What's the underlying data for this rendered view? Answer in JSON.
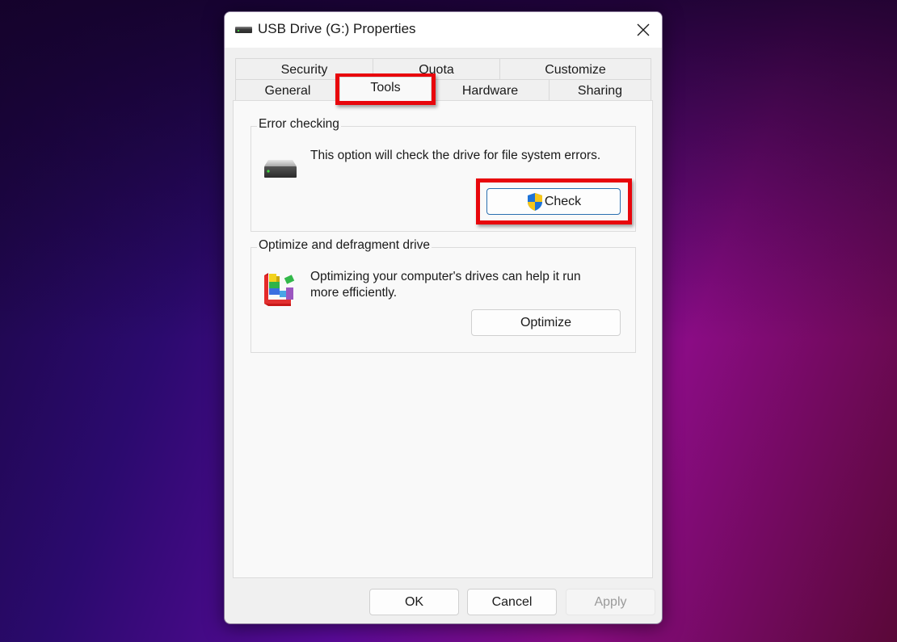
{
  "window": {
    "title": "USB Drive (G:) Properties",
    "title_icon": "usb-drive-icon",
    "close_icon": "close-icon"
  },
  "tabs": {
    "row_top": [
      {
        "label": "Security"
      },
      {
        "label": "Quota"
      },
      {
        "label": "Customize"
      }
    ],
    "row_bottom": [
      {
        "label": "General"
      },
      {
        "label": "Tools",
        "selected": true
      },
      {
        "label": "Hardware"
      },
      {
        "label": "Sharing"
      }
    ]
  },
  "error_checking": {
    "title": "Error checking",
    "description": "This option will check the drive for file system errors.",
    "icon": "hard-drive-icon",
    "button_label": "Check",
    "button_icon": "uac-shield-icon"
  },
  "optimize": {
    "title": "Optimize and defragment drive",
    "description": "Optimizing your computer's drives can help it run more efficiently.",
    "icon": "defragment-icon",
    "button_label": "Optimize"
  },
  "footer": {
    "ok_label": "OK",
    "cancel_label": "Cancel",
    "apply_label": "Apply",
    "apply_disabled": true
  },
  "annotations": {
    "highlight_color": "#e8060c",
    "highlighted": [
      "Tools",
      "Check"
    ]
  }
}
